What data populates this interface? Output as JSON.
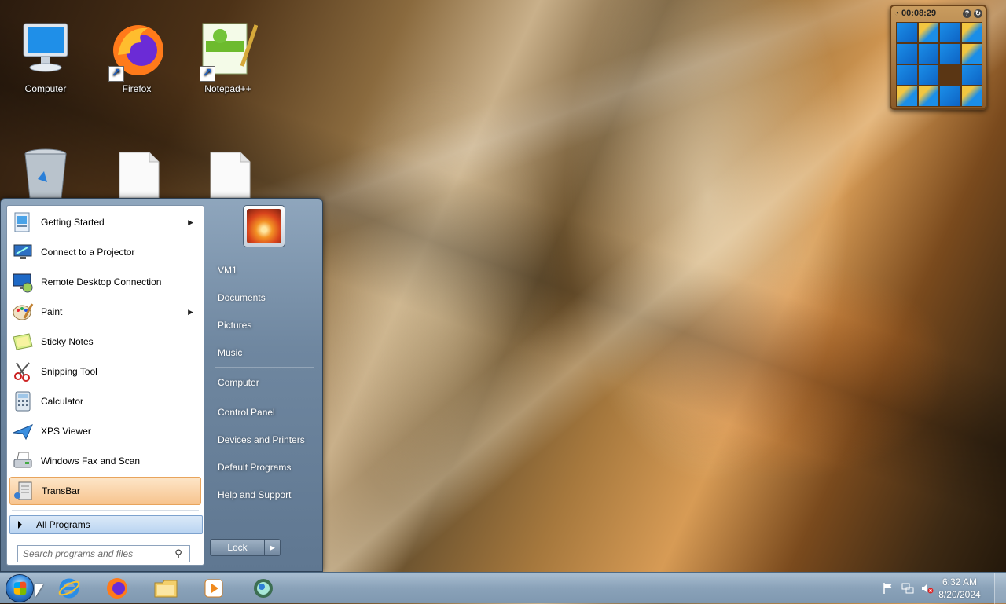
{
  "desktop": {
    "icons": [
      {
        "label": "Computer",
        "icon": "computer-icon"
      },
      {
        "label": "Firefox",
        "icon": "firefox-icon"
      },
      {
        "label": "Notepad++",
        "icon": "notepad-plus-plus-icon"
      },
      {
        "label": "",
        "icon": "recycle-bin-icon"
      },
      {
        "label": "",
        "icon": "blank-file-icon"
      },
      {
        "label": "",
        "icon": "blank-file-icon"
      }
    ]
  },
  "gadget": {
    "timer": "00:08:29",
    "icon": "puzzle-gadget-icon"
  },
  "start_menu": {
    "programs": [
      {
        "label": "Getting Started",
        "icon": "getting-started-icon",
        "has_submenu": true
      },
      {
        "label": "Connect to a Projector",
        "icon": "projector-icon",
        "has_submenu": false
      },
      {
        "label": "Remote Desktop Connection",
        "icon": "remote-desktop-icon",
        "has_submenu": false
      },
      {
        "label": "Paint",
        "icon": "paint-icon",
        "has_submenu": true
      },
      {
        "label": "Sticky Notes",
        "icon": "sticky-notes-icon",
        "has_submenu": false
      },
      {
        "label": "Snipping Tool",
        "icon": "snipping-tool-icon",
        "has_submenu": false
      },
      {
        "label": "Calculator",
        "icon": "calculator-icon",
        "has_submenu": false
      },
      {
        "label": "XPS Viewer",
        "icon": "xps-viewer-icon",
        "has_submenu": false
      },
      {
        "label": "Windows Fax and Scan",
        "icon": "fax-scan-icon",
        "has_submenu": false
      },
      {
        "label": "TransBar",
        "icon": "transbar-icon",
        "has_submenu": false,
        "highlighted": true
      }
    ],
    "all_programs_label": "All Programs",
    "search_placeholder": "Search programs and files",
    "right_items": [
      {
        "label": "VM1"
      },
      {
        "label": "Documents"
      },
      {
        "label": "Pictures"
      },
      {
        "label": "Music"
      },
      {
        "label": "Computer"
      },
      {
        "label": "Control Panel"
      },
      {
        "label": "Devices and Printers"
      },
      {
        "label": "Default Programs"
      },
      {
        "label": "Help and Support"
      }
    ],
    "lock_label": "Lock"
  },
  "taskbar": {
    "apps": [
      {
        "icon": "internet-explorer-icon"
      },
      {
        "icon": "firefox-icon"
      },
      {
        "icon": "file-explorer-icon"
      },
      {
        "icon": "media-player-icon"
      },
      {
        "icon": "network-globe-icon"
      }
    ],
    "tray_icons": [
      "action-center-flag-icon",
      "network-icon",
      "volume-muted-icon"
    ],
    "clock_time": "6:32 AM",
    "clock_date": "8/20/2024"
  },
  "colors": {
    "highlight": "#f7c48e",
    "start_menu_right": "#6f87a0",
    "taskbar": "#8aa2b9"
  }
}
